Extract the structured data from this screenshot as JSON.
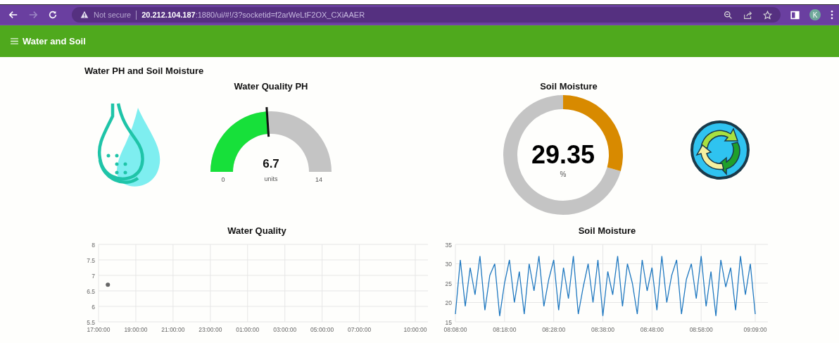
{
  "browser": {
    "security_label": "Not secure",
    "url": "**20.212.104.187**:1880/ui/#!/3?socketid=f2arWeLtF2OX_CXiAAER",
    "avatar_initial": "K"
  },
  "header": {
    "title": "Water and Soil"
  },
  "group_title": "Water PH and Soil Moisture",
  "gauge": {
    "title": "Water Quality PH",
    "value": "6.7",
    "units": "units",
    "min_label": "0",
    "max_label": "14"
  },
  "donut": {
    "title": "Soil Moisture",
    "value": "29.35",
    "units": "%"
  },
  "charts": [
    {
      "chart_data": {
        "type": "scatter",
        "title": "Water Quality",
        "grid": true,
        "ylim": [
          5.5,
          8
        ],
        "categories": [
          "17:00:00",
          null,
          null,
          null,
          "19:00:00",
          null,
          null,
          null,
          "21:00:00",
          null,
          null,
          null,
          "23:00:00",
          null,
          null,
          null,
          "01:00:00",
          null,
          null,
          null,
          "03:00:00",
          null,
          null,
          null,
          "05:00:00",
          null,
          null,
          null,
          "07:00:00",
          null,
          null,
          null,
          null,
          null,
          "10:00:00"
        ],
        "series": [
          {
            "color": "#666666",
            "values": [
              null,
              6.7,
              null,
              null,
              null,
              null,
              null,
              null,
              null,
              null,
              null,
              null,
              null,
              null,
              null,
              null,
              null,
              null,
              null,
              null,
              null,
              null,
              null,
              null,
              null,
              null,
              null,
              null,
              null,
              null,
              null,
              null,
              null,
              null,
              null
            ]
          }
        ],
        "yticks": [
          {
            "value": 5.5,
            "label": "5.5"
          },
          {
            "value": 6,
            "label": "6"
          },
          {
            "value": 6.5,
            "label": "6.5"
          },
          {
            "value": 7,
            "label": "7"
          },
          {
            "value": 7.5,
            "label": "7.5"
          },
          {
            "value": 8,
            "label": "8"
          }
        ]
      }
    },
    {
      "chart_data": {
        "type": "line",
        "title": "Soil Moisture",
        "grid": true,
        "ylim": [
          15,
          35
        ],
        "categories": [
          "08:08:00",
          null,
          null,
          null,
          null,
          null,
          null,
          null,
          null,
          null,
          "08:18:00",
          null,
          null,
          null,
          null,
          null,
          null,
          null,
          null,
          null,
          "08:28:00",
          null,
          null,
          null,
          null,
          null,
          null,
          null,
          null,
          null,
          "08:38:00",
          null,
          null,
          null,
          null,
          null,
          null,
          null,
          null,
          null,
          "08:48:00",
          null,
          null,
          null,
          null,
          null,
          null,
          null,
          null,
          null,
          "08:58:00",
          null,
          null,
          null,
          null,
          null,
          null,
          null,
          null,
          null,
          null,
          "09:09:00"
        ],
        "series": [
          {
            "color": "#1f78c0",
            "values": [
              17,
              31,
              19,
              29,
              22,
              32,
              18,
              27,
              30,
              16.5,
              25,
              31,
              20,
              28,
              17,
              30,
              23,
              32,
              19,
              26,
              31,
              18,
              29,
              21,
              32,
              17,
              24,
              30,
              20,
              31,
              16.5,
              28,
              22,
              32,
              19,
              30,
              25,
              17,
              31,
              23,
              29,
              18,
              32,
              20,
              27,
              31,
              17,
              26,
              30,
              21,
              32,
              19,
              28,
              16.5,
              31,
              24,
              29,
              18,
              32,
              22,
              30,
              17
            ]
          }
        ],
        "yticks": [
          {
            "value": 15,
            "label": "15"
          },
          {
            "value": 20,
            "label": "20"
          },
          {
            "value": 25,
            "label": "25"
          },
          {
            "value": 30,
            "label": "30"
          },
          {
            "value": 35,
            "label": "35"
          }
        ]
      }
    }
  ]
}
